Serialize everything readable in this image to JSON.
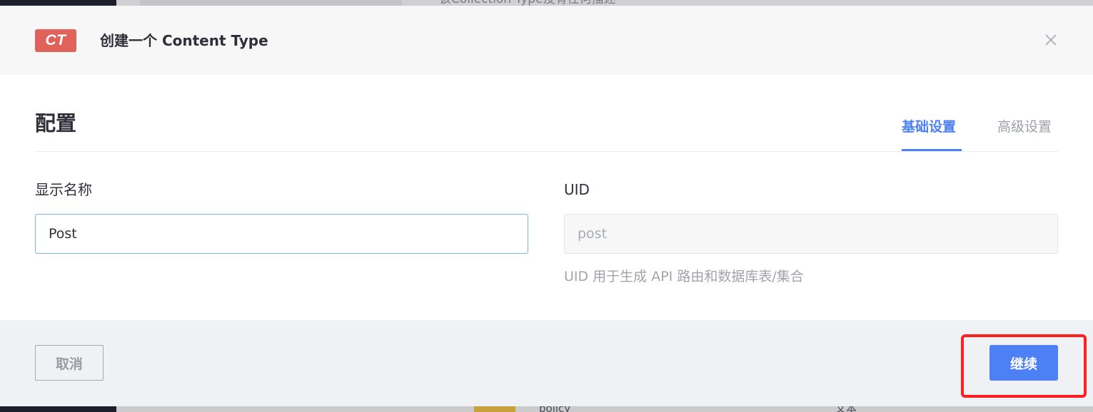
{
  "background": {
    "description_text": "该Collection Type没有任何描述",
    "row_text": "policy",
    "row_text2": "文本"
  },
  "modal": {
    "badge": "CT",
    "title": "创建一个 Content Type",
    "close_icon": "close-icon",
    "section_title": "配置",
    "tabs": [
      {
        "label": "基础设置",
        "active": true
      },
      {
        "label": "高级设置",
        "active": false
      }
    ],
    "fields": {
      "display_name": {
        "label": "显示名称",
        "value": "Post"
      },
      "uid": {
        "label": "UID",
        "value": "post",
        "hint": "UID 用于生成 API 路由和数据库表/集合"
      }
    },
    "footer": {
      "cancel_label": "取消",
      "continue_label": "继续"
    }
  },
  "colors": {
    "accent": "#4d7ff5",
    "badge": "#e0625a",
    "highlight": "#ff1f1f"
  }
}
